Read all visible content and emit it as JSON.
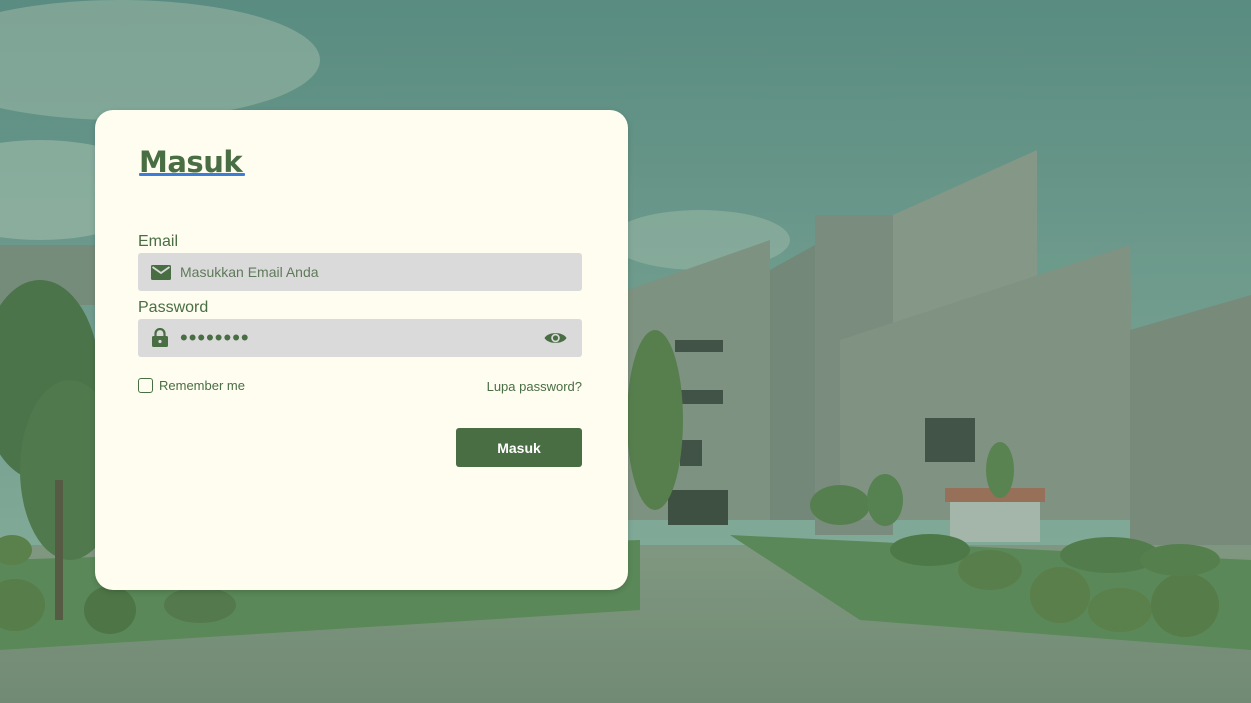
{
  "login": {
    "title": "Masuk",
    "email": {
      "label": "Email",
      "placeholder": "Masukkan Email Anda",
      "icon": "mail-icon"
    },
    "password": {
      "label": "Password",
      "value": "12345678",
      "lock_icon": "lock-icon",
      "toggle_icon": "eye-icon"
    },
    "remember_label": "Remember me",
    "remember_checked": false,
    "forgot_label": "Lupa password?",
    "submit_label": "Masuk"
  },
  "colors": {
    "primary": "#4a6e44",
    "card_background": "#fefdf0",
    "input_background": "#dadada",
    "title_underline": "#3b7dd8"
  }
}
